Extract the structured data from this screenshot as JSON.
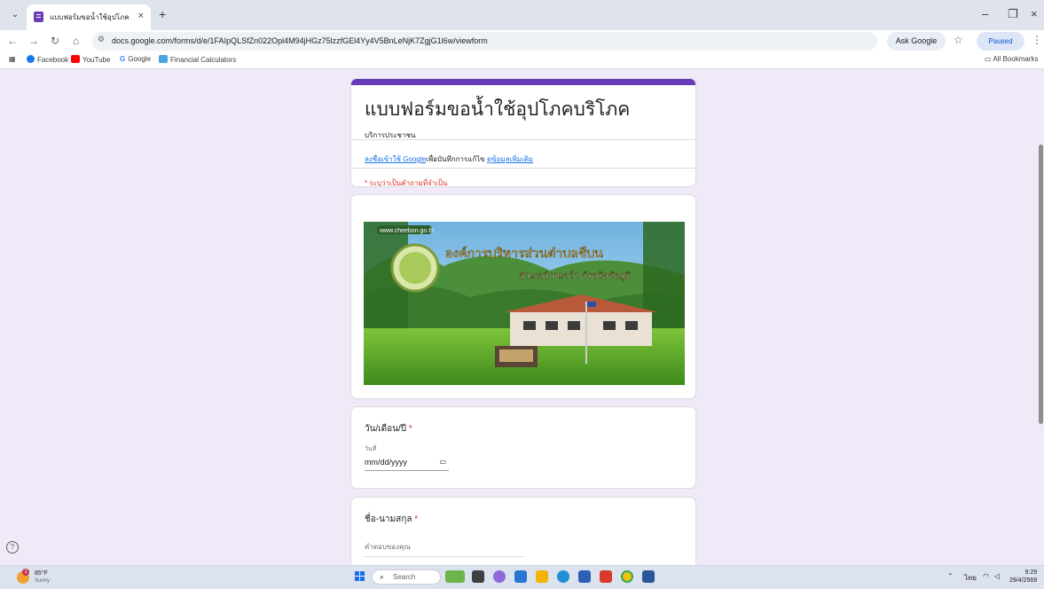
{
  "browser": {
    "tab_title": "แบบฟอร์มขอน้ำใช้อุปโภคบริโภค",
    "tab_close": "×",
    "new_tab": "+",
    "url": "docs.google.com/forms/d/e/1FAIpQLSfZn022Opl4M94jHGz75lzzfGEl4Yy4V5BnLeNjK7ZgjG1l6w/viewform",
    "ask_google": "Ask Google",
    "profile_status": "Paused",
    "bookmarks": [
      "Facebook",
      "YouTube",
      "Google",
      "Financial Calculators"
    ],
    "all_bookmarks": "All Bookmarks",
    "icons": [
      "tab-search-icon",
      "back-icon",
      "forward-icon",
      "reload-icon",
      "home-icon",
      "site-info-icon",
      "star-icon",
      "menu-icon",
      "apps-icon",
      "folder-icon"
    ]
  },
  "form": {
    "title": "แบบฟอร์มขอน้ำใช้อุปโภคบริโภค",
    "description": "บริการประชาชน",
    "signin_link": "ลงชื่อเข้าใช้ Google",
    "signin_text": "เพื่อบันทึกการแก้ไข",
    "learn_more": "ดูข้อมูลเพิ่มเติม",
    "required_note": "* ระบุว่าเป็นคำถามที่จำเป็น",
    "banner": {
      "website": "www.cheebon.go.th",
      "org_name": "องค์การบริหารส่วนตำบลชีบน",
      "district": "อำเภอบ้านเขว้า จังหวัดชัยภูมิ"
    },
    "questions": [
      {
        "title": "วัน/เดือน/ปี",
        "required_mark": "*",
        "sublabel": "วันที่",
        "placeholder": "mm/dd/yyyy"
      },
      {
        "title": "ชื่อ-นามสกุล",
        "required_mark": "*",
        "placeholder": "คำตอบของคุณ"
      }
    ],
    "theme_color": "#673ab7",
    "background_color": "#efe9f8"
  },
  "taskbar": {
    "temperature": "85°F",
    "condition": "Sunny",
    "weather_badge": "1",
    "search": "Search",
    "language": "ไทย",
    "time": "9:29",
    "date": "29/4/2569"
  }
}
